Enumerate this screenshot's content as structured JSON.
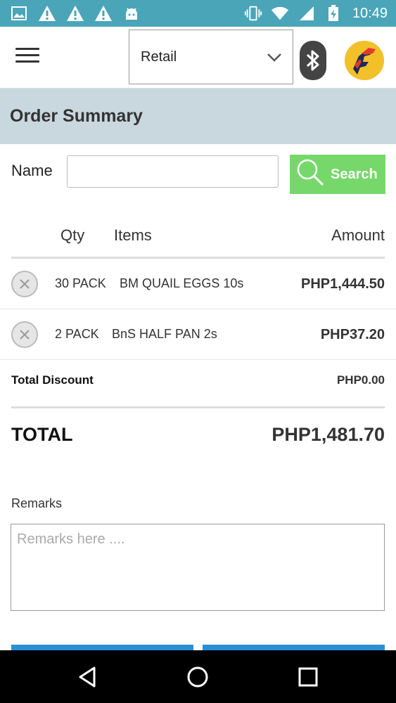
{
  "status_bar": {
    "left_icons": [
      "image-icon",
      "alert-icon",
      "alert-icon",
      "alert-icon",
      "android-icon"
    ],
    "right_icons": [
      "vibrate-icon",
      "wifi-icon",
      "signal-icon",
      "battery-charging-icon"
    ],
    "time": "10:49"
  },
  "app_bar": {
    "menu_icon": "hamburger-menu-icon",
    "mode_select": {
      "value": "Retail"
    },
    "bluetooth_icon": "bluetooth-icon",
    "logo": "brand-logo"
  },
  "order": {
    "title": "Order Summary",
    "name_label": "Name",
    "name_value": "",
    "search_label": "Search",
    "columns": {
      "qty": "Qty",
      "items": "Items",
      "amount": "Amount"
    },
    "items": [
      {
        "qty": "30 PACK",
        "name": "BM QUAIL EGGS 10s",
        "amount": "PHP1,444.50"
      },
      {
        "qty": "2 PACK",
        "name": "BnS HALF PAN 2s",
        "amount": "PHP37.20"
      }
    ],
    "discount_label": "Total Discount",
    "discount_value": "PHP0.00",
    "total_label": "TOTAL",
    "total_value": "PHP1,481.70",
    "remarks_label": "Remarks",
    "remarks_placeholder": "Remarks here ...."
  },
  "colors": {
    "status_bar": "#4aa5b9",
    "header_band": "#c9d8df",
    "search_button": "#76d86a",
    "action_button": "#2b8fd6"
  },
  "nav_bar": {
    "icons": [
      "back-icon",
      "home-icon",
      "recents-icon"
    ]
  }
}
